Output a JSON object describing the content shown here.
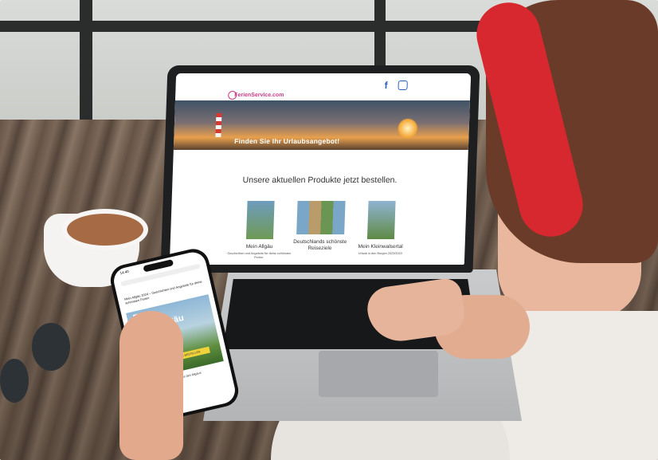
{
  "laptop_site": {
    "logo_text": "FerienService.com",
    "social_icons": [
      "facebook-icon",
      "instagram-icon"
    ],
    "hero_text": "Finden Sie Ihr Urlaubsangebot!",
    "headline": "Unsere aktuellen Produkte jetzt bestellen.",
    "products": [
      {
        "title": "Mein Allgäu",
        "subtitle": "Geschichten und Angebote für deine schönsten Ferien."
      },
      {
        "title": "Deutschlands schönste Reiseziele",
        "subtitle": ""
      },
      {
        "title": "Mein Kleinwalsertal",
        "subtitle": "Urlaub in den Bergen 2023/2024"
      }
    ]
  },
  "phone_screen": {
    "time": "14:40",
    "post_text": "Mein Allgäu 2024 – Geschichten und Angebote für deine schönsten Ferien",
    "ad_title": "Mein Allgäu",
    "ad_banner": "JETZT KOSTENLOS BESTELLEN",
    "caption": "Entdecken Sie die Sonnenseite des Allgäus"
  },
  "colors": {
    "brand_pink": "#c63d87",
    "social_blue": "#2c5fb6",
    "scarf_red": "#d8282f"
  }
}
